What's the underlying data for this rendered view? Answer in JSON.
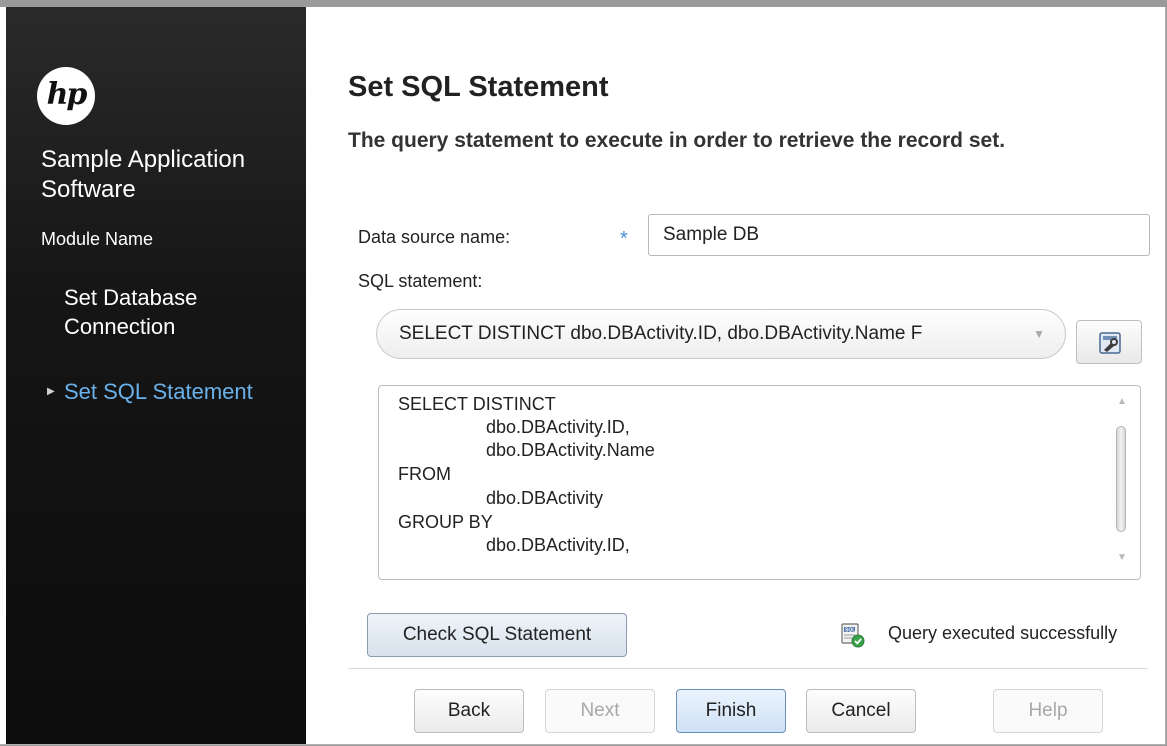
{
  "sidebar": {
    "logo_text": "hp",
    "app_name": "Sample Application Software",
    "module_name": "Module Name",
    "items": [
      {
        "label": "Set Database Connection",
        "active": false
      },
      {
        "label": "Set SQL Statement",
        "active": true
      }
    ]
  },
  "page": {
    "title": "Set SQL Statement",
    "subtitle": "The query statement to execute in order to retrieve the record set."
  },
  "form": {
    "data_source_label": "Data source name:",
    "required_marker": "*",
    "data_source_value": "Sample DB",
    "sql_label": "SQL statement:",
    "sql_select_value": "SELECT DISTINCT dbo.DBActivity.ID, dbo.DBActivity.Name F",
    "sql_lines": [
      "SELECT DISTINCT",
      "dbo.DBActivity.ID,",
      "dbo.DBActivity.Name",
      "FROM",
      "dbo.DBActivity",
      "GROUP BY",
      "dbo.DBActivity.ID,"
    ]
  },
  "check": {
    "button_label": "Check SQL Statement",
    "status": "Query executed successfully",
    "status_icon": "sql-success-icon"
  },
  "footer": {
    "back": "Back",
    "next": "Next",
    "finish": "Finish",
    "cancel": "Cancel",
    "help": "Help"
  },
  "colors": {
    "active_nav": "#6ab1ea",
    "required": "#4a90d6",
    "sidebar_bg": "#121212"
  }
}
